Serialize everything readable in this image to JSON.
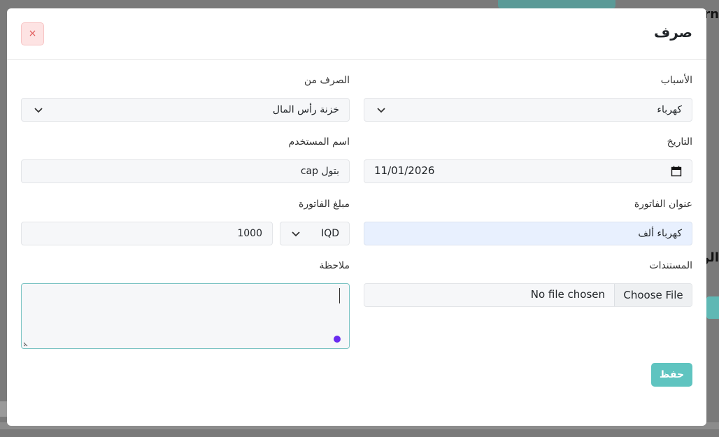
{
  "modal": {
    "title": "صرف",
    "close_icon": "×"
  },
  "form": {
    "reasons": {
      "label": "الأسباب",
      "value": "كهرباء"
    },
    "source": {
      "label": "الصرف من",
      "value": "خزنة رأس المال"
    },
    "date": {
      "label": "التاريخ",
      "value": "11/01/2026"
    },
    "username": {
      "label": "اسم المستخدم",
      "value": "بتول cap"
    },
    "invoice_title": {
      "label": "عنوان الفاتورة",
      "value": "كهرباء ألف"
    },
    "invoice_amount": {
      "label": "مبلغ الفاتورة",
      "currency": "IQD",
      "value": "1000"
    },
    "documents": {
      "label": "المستندات",
      "button": "Choose File",
      "status": "No file chosen"
    },
    "note": {
      "label": "ملاحظة"
    }
  },
  "actions": {
    "save_label": "حفظ"
  },
  "icons": {
    "close": "close-icon",
    "chevron": "chevron-down-icon",
    "calendar": "calendar-icon"
  },
  "colors": {
    "save": "#5fc4c0",
    "close_bg": "#fde3e3",
    "close_fg": "#e05656",
    "focus_blue": "#e8f0fe"
  }
}
